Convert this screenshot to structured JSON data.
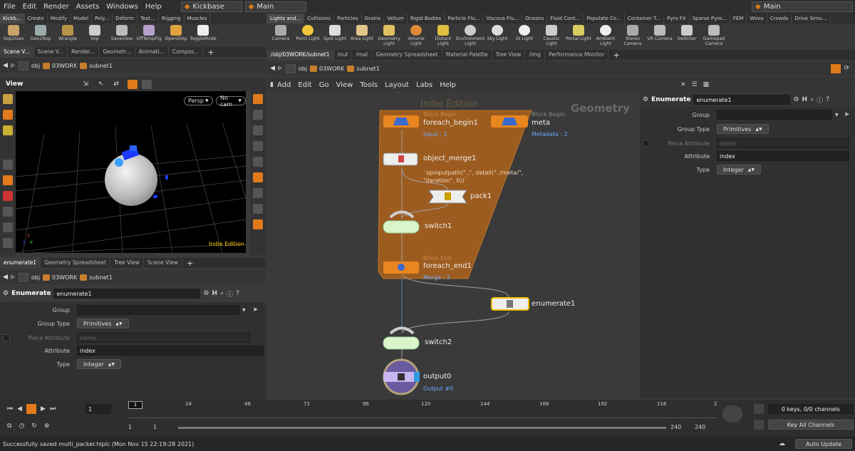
{
  "menubar": {
    "items": [
      "File",
      "Edit",
      "Render",
      "Assets",
      "Windows",
      "Help"
    ],
    "desktop": "Kickbase",
    "main_left": "Main",
    "main_right": "Main"
  },
  "shelf_left": {
    "tabs": [
      "Kickb...",
      "Create",
      "Modify",
      "Model",
      "Poly...",
      "Deform",
      "Text...",
      "Rigging",
      "Muscles"
    ],
    "tools": [
      "Sop2Geo",
      "Geo2Rop",
      "Wrangle",
      "Vop",
      "SaveView",
      "OffTempFlg",
      "OpenSHip",
      "ToggleMode"
    ]
  },
  "shelf_right": {
    "tabs": [
      "Lights and...",
      "Collisions",
      "Particles",
      "Grains",
      "Vellum",
      "Rigid Bodies",
      "Particle Flu...",
      "Viscous Flu...",
      "Oceans",
      "Fluid Cont...",
      "Populate Co...",
      "Container T...",
      "Pyro FX",
      "Sparse Pyro...",
      "FEM",
      "Wires",
      "Crowds",
      "Drive Simu..."
    ],
    "tools": [
      "Camera",
      "Point Light",
      "Spot Light",
      "Area Light",
      "Geometry Light",
      "Volume Light",
      "Distant Light",
      "Environment Light",
      "Sky Light",
      "GI Light",
      "Caustic Light",
      "Portal Light",
      "Ambient Light",
      "Stereo Camera",
      "VR Camera",
      "Switcher",
      "Gamepad Camera"
    ]
  },
  "left_tabs": [
    "Scene V...",
    "Scene V...",
    "Render...",
    "Geometr...",
    "Animati...",
    "Compos..."
  ],
  "path": {
    "obj": "obj",
    "work": "03WORK",
    "subnet": "subnet1"
  },
  "viewport": {
    "title": "View",
    "persp": "Persp",
    "cam": "No cam",
    "edition": "Indie Edition",
    "axes": {
      "x": "x",
      "y": "y",
      "z": "z"
    }
  },
  "left_lower_tabs": [
    "enumerate1",
    "Geometry Spreadsheet",
    "Tree View",
    "Scene View"
  ],
  "params": {
    "type_label": "Enumerate",
    "node_name": "enumerate1",
    "rows": [
      {
        "label": "Group",
        "value": ""
      },
      {
        "label": "Group Type",
        "value": "Primitives"
      },
      {
        "label": "Piece Attribute",
        "value": "name"
      },
      {
        "label": "Attribute",
        "value": "index"
      },
      {
        "label": "Type",
        "value": "Integer"
      }
    ]
  },
  "right_tabs": [
    "/obj/03WORK/subnet1",
    "/out",
    "/mat",
    "Geometry Spreadsheet",
    "Material Palette",
    "Tree View",
    "/img",
    "Performance Monitor"
  ],
  "net_menu": [
    "Add",
    "Edit",
    "Go",
    "View",
    "Tools",
    "Layout",
    "Labs",
    "Help"
  ],
  "net": {
    "watermark": "Indie Edition",
    "context": "Geometry",
    "nodes": {
      "foreach_begin1": {
        "name": "foreach_begin1",
        "tag": "Block Begin",
        "sub": "Input : 2"
      },
      "meta": {
        "name": "meta",
        "tag": "Block Begin",
        "sub": "Metadata : 2"
      },
      "object_merge1": {
        "name": "object_merge1",
        "expr": "`opinputpath(\"..\", detail(\"../meta/\", \"iteration\", 0))`"
      },
      "pack1": {
        "name": "pack1"
      },
      "switch1": {
        "name": "switch1"
      },
      "foreach_end1": {
        "name": "foreach_end1",
        "tag": "Block End",
        "sub": "Merge : 3"
      },
      "enumerate1": {
        "name": "enumerate1"
      },
      "switch2": {
        "name": "switch2"
      },
      "output0": {
        "name": "output0",
        "sub": "Output #0"
      }
    }
  },
  "timeline": {
    "frame": "1",
    "ticks": [
      "24",
      "48",
      "72",
      "96",
      "120",
      "144",
      "168",
      "192",
      "216",
      "2"
    ],
    "start": "1",
    "start2": "1",
    "end": "240",
    "end2": "240",
    "keys": "0 keys, 0/0 channels",
    "key_all": "Key All Channels",
    "auto_update": "Auto Update"
  },
  "status": "Successfully saved multi_packer.hiplc (Mon Nov 15 22:19:28 2021)",
  "colors": {
    "accent": "#e07a1a",
    "panel": "#3a3a3a",
    "node_green": "#d9f5c9",
    "node_orange": "#e8861f"
  }
}
